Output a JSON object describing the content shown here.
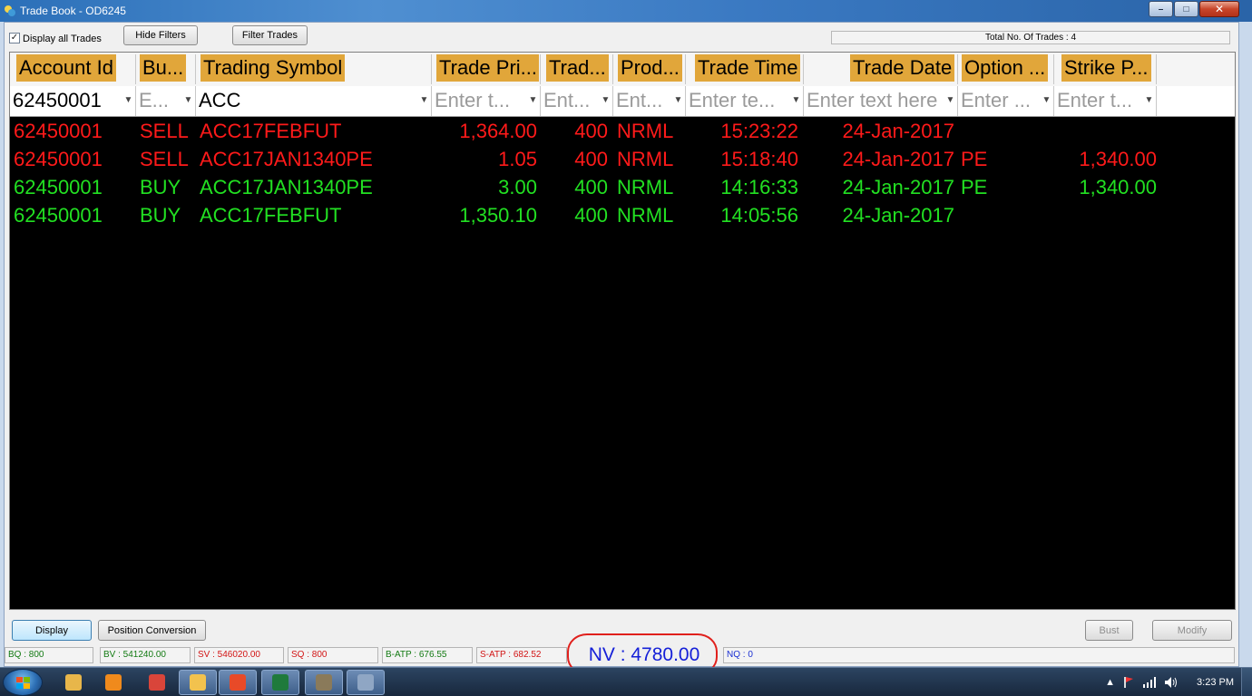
{
  "window": {
    "title": "Trade Book - OD6245",
    "minimize_glyph": "–",
    "maximize_glyph": "□",
    "close_glyph": "✕"
  },
  "toolbar": {
    "display_all_label": "Display all Trades",
    "display_all_checked": true,
    "check_glyph": "✓",
    "hide_filters_label": "Hide Filters",
    "filter_trades_label": "Filter Trades",
    "total_trades": "Total No. Of Trades : 4"
  },
  "columns": [
    {
      "key": "account",
      "label": "Account Id"
    },
    {
      "key": "buysell",
      "label": "Bu..."
    },
    {
      "key": "symbol",
      "label": "Trading Symbol"
    },
    {
      "key": "price",
      "label": "Trade Pri..."
    },
    {
      "key": "qty",
      "label": "Trad..."
    },
    {
      "key": "product",
      "label": "Prod..."
    },
    {
      "key": "time",
      "label": "Trade Time"
    },
    {
      "key": "date",
      "label": "Trade Date"
    },
    {
      "key": "option",
      "label": "Option ..."
    },
    {
      "key": "strike",
      "label": "Strike P..."
    }
  ],
  "filters": {
    "account": {
      "value": "62450001",
      "placeholder": ""
    },
    "buysell": {
      "value": "",
      "placeholder": "E..."
    },
    "symbol": {
      "value": "ACC",
      "placeholder": ""
    },
    "price": {
      "value": "",
      "placeholder": "Enter t..."
    },
    "qty": {
      "value": "",
      "placeholder": "Ent..."
    },
    "product": {
      "value": "",
      "placeholder": "Ent..."
    },
    "time": {
      "value": "",
      "placeholder": "Enter te..."
    },
    "date": {
      "value": "",
      "placeholder": "Enter text here"
    },
    "option": {
      "value": "",
      "placeholder": "Enter ..."
    },
    "strike": {
      "value": "",
      "placeholder": "Enter t..."
    }
  },
  "filter_icon_glyph": "▼",
  "trades": [
    {
      "side": "sell",
      "account": "62450001",
      "buysell": "SELL",
      "symbol": "ACC17FEBFUT",
      "price": "1,364.00",
      "qty": "400",
      "product": "NRML",
      "time": "15:23:22",
      "date": "24-Jan-2017",
      "option": "",
      "strike": ""
    },
    {
      "side": "sell",
      "account": "62450001",
      "buysell": "SELL",
      "symbol": "ACC17JAN1340PE",
      "price": "1.05",
      "qty": "400",
      "product": "NRML",
      "time": "15:18:40",
      "date": "24-Jan-2017",
      "option": "PE",
      "strike": "1,340.00"
    },
    {
      "side": "buy",
      "account": "62450001",
      "buysell": "BUY",
      "symbol": "ACC17JAN1340PE",
      "price": "3.00",
      "qty": "400",
      "product": "NRML",
      "time": "14:16:33",
      "date": "24-Jan-2017",
      "option": "PE",
      "strike": "1,340.00"
    },
    {
      "side": "buy",
      "account": "62450001",
      "buysell": "BUY",
      "symbol": "ACC17FEBFUT",
      "price": "1,350.10",
      "qty": "400",
      "product": "NRML",
      "time": "14:05:56",
      "date": "24-Jan-2017",
      "option": "",
      "strike": ""
    }
  ],
  "colors": {
    "sell": "#ff1a1a",
    "buy": "#22e022",
    "header_highlight": "#e1a63a",
    "nv_text": "#1520d8",
    "annotation_circle": "#e0201c"
  },
  "bottom_buttons": {
    "display_label": "Display",
    "position_conversion_label": "Position Conversion",
    "bust_label": "Bust",
    "modify_label": "Modify"
  },
  "status": {
    "bq": "BQ : 800",
    "bv": "BV : 541240.00",
    "sv": "SV : 546020.00",
    "sq": "SQ : 800",
    "batp": "B-ATP : 676.55",
    "satp": "S-ATP : 682.52",
    "nv": "NV : 4780.00",
    "nq": "NQ : 0"
  },
  "taskbar": {
    "clock": "3:23 PM",
    "tray_up_arrow": "▲",
    "apps": [
      {
        "name": "explorer-icon",
        "color": "#e8b64a"
      },
      {
        "name": "media-player-icon",
        "color": "#f08a1c"
      },
      {
        "name": "chrome-icon",
        "color": "#d9453a"
      },
      {
        "name": "folder-icon",
        "color": "#f2c24e"
      },
      {
        "name": "trading-app-icon",
        "color": "#e84a28"
      },
      {
        "name": "excel-icon",
        "color": "#1f7a3c"
      },
      {
        "name": "tool-app-icon",
        "color": "#8a7a5a"
      },
      {
        "name": "calculator-icon",
        "color": "#8fa6c4"
      }
    ]
  }
}
